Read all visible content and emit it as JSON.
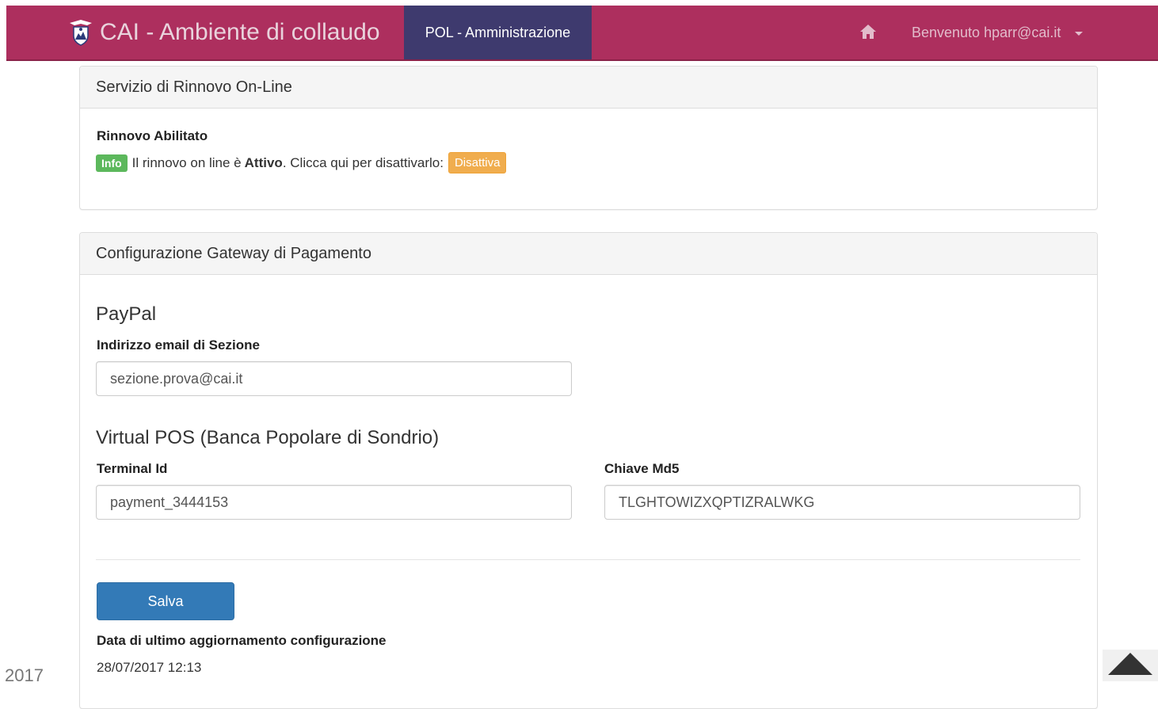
{
  "navbar": {
    "brand": "CAI - Ambiente di collaudo",
    "active_section": "POL - Amministrazione",
    "home_icon": "home-icon",
    "user_greeting": "Benvenuto hparr@cai.it",
    "colors": {
      "bar": "#ad2f5e",
      "active": "#3e3a6e"
    }
  },
  "renewal_panel": {
    "title": "Servizio di Rinnovo On-Line",
    "status_heading": "Rinnovo Abilitato",
    "info_badge": "Info",
    "text_before": "Il rinnovo on line è",
    "status_word": "Attivo",
    "text_after": ". Clicca qui per disattivarlo:",
    "deactivate_label": "Disattiva"
  },
  "gateway_panel": {
    "title": "Configurazione Gateway di Pagamento",
    "paypal": {
      "heading": "PayPal",
      "email_label": "Indirizzo email di Sezione",
      "email_value": "sezione.prova@cai.it"
    },
    "virtual_pos": {
      "heading": "Virtual POS (Banca Popolare di Sondrio)",
      "terminal_label": "Terminal Id",
      "terminal_value": "payment_3444153",
      "md5_label": "Chiave Md5",
      "md5_value": "TLGHTOWIZXQPTIZRALWKG"
    },
    "save_label": "Salva",
    "last_update_label": "Data di ultimo aggiornamento configurazione",
    "last_update_value": "28/07/2017 12:13"
  },
  "footer": {
    "year_fragment": "2017"
  }
}
